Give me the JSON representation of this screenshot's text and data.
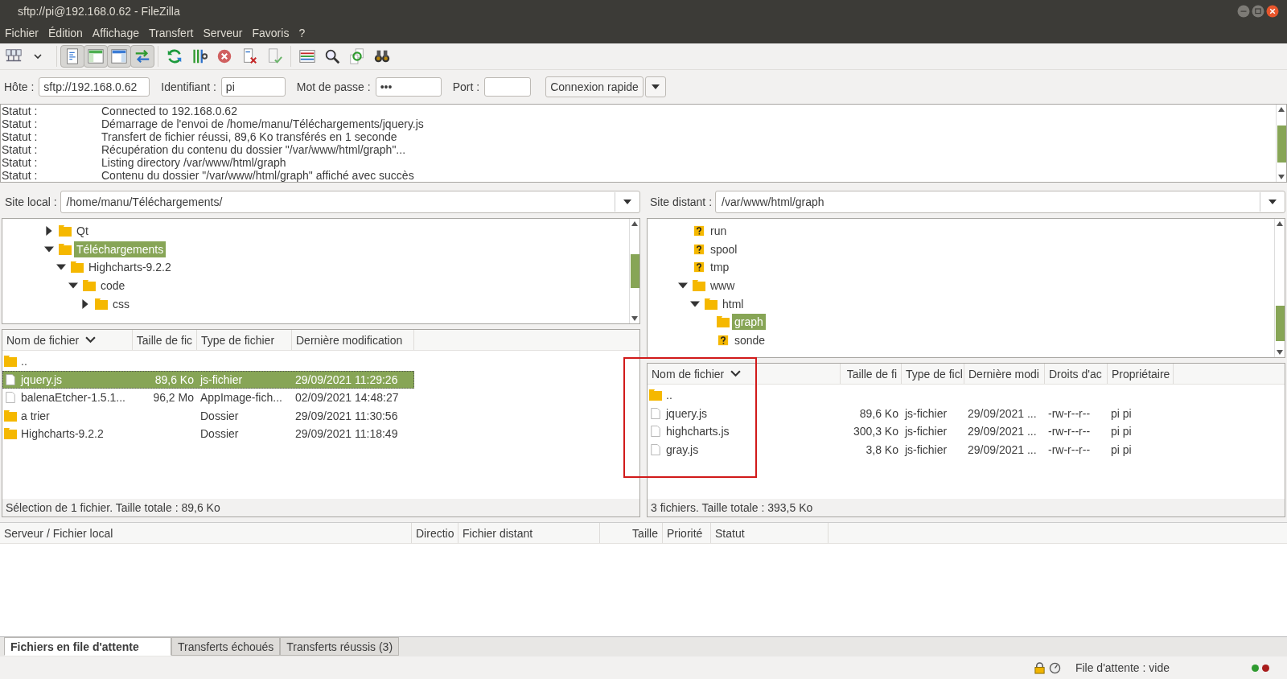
{
  "window": {
    "title": "sftp://pi@192.168.0.62 - FileZilla"
  },
  "menu": [
    "Fichier",
    "Édition",
    "Affichage",
    "Transfert",
    "Serveur",
    "Favoris",
    "?"
  ],
  "toolbar": {
    "toggles": [
      {
        "on": true
      },
      {
        "on": true
      },
      {
        "on": true
      },
      {
        "on": true
      }
    ]
  },
  "quickconnect": {
    "fields": [
      {
        "label": "Hôte :",
        "value": "sftp://192.168.0.62"
      },
      {
        "label": "Identifiant :",
        "value": "pi"
      },
      {
        "label": "Mot de passe :",
        "value": "•••"
      },
      {
        "label": "Port :"
      }
    ],
    "button": "Connexion rapide"
  },
  "log": [
    {
      "label": "Statut :",
      "message": "Connected to 192.168.0.62"
    },
    {
      "label": "Statut :",
      "message": "Démarrage de l'envoi de /home/manu/Téléchargements/jquery.js"
    },
    {
      "label": "Statut :",
      "message": "Transfert de fichier réussi, 89,6 Ko transférés en 1 seconde"
    },
    {
      "label": "Statut :",
      "message": "Récupération du contenu du dossier \"/var/www/html/graph\"..."
    },
    {
      "label": "Statut :",
      "message": "Listing directory /var/www/html/graph"
    },
    {
      "label": "Statut :",
      "message": "Contenu du dossier \"/var/www/html/graph\" affiché avec succès"
    }
  ],
  "local": {
    "label": "Site local :",
    "path": "/home/manu/Téléchargements/",
    "tree": [
      {
        "name": "Qt",
        "kind": "folder",
        "expanded": false,
        "selected": false
      },
      {
        "name": "Téléchargements",
        "kind": "folder",
        "expanded": true,
        "selected": true,
        "children": [
          {
            "name": "Highcharts-9.2.2",
            "kind": "folder",
            "expanded": true,
            "selected": false,
            "children": [
              {
                "name": "code",
                "kind": "folder",
                "expanded": true,
                "selected": false,
                "children": [
                  {
                    "name": "css",
                    "kind": "folder",
                    "expanded": false,
                    "selected": false
                  }
                ]
              }
            ]
          }
        ]
      }
    ],
    "columns": [
      "Nom de fichier",
      "Taille de fic",
      "Type de fichier",
      "Dernière modification"
    ],
    "rows": [
      {
        "kind": "folder",
        "name": "..",
        "selected": false
      },
      {
        "kind": "file",
        "name": "jquery.js",
        "size": "89,6 Ko",
        "type": "js-fichier",
        "modified": "29/09/2021 11:29:26",
        "selected": true
      },
      {
        "kind": "file",
        "name": "balenaEtcher-1.5.1...",
        "size": "96,2 Mo",
        "type": "AppImage-fich...",
        "modified": "02/09/2021 14:48:27",
        "selected": false
      },
      {
        "kind": "folder",
        "name": "a trier",
        "type": "Dossier",
        "modified": "29/09/2021 11:30:56",
        "selected": false
      },
      {
        "kind": "folder",
        "name": "Highcharts-9.2.2",
        "type": "Dossier",
        "modified": "29/09/2021 11:18:49",
        "selected": false
      }
    ],
    "status": "Sélection de 1 fichier. Taille totale : 89,6 Ko"
  },
  "remote": {
    "label": "Site distant :",
    "path": "/var/www/html/graph",
    "tree": [
      {
        "name": "run",
        "kind": "unknown",
        "selected": false
      },
      {
        "name": "spool",
        "kind": "unknown",
        "selected": false
      },
      {
        "name": "tmp",
        "kind": "unknown",
        "selected": false
      },
      {
        "name": "www",
        "kind": "folder",
        "expanded": true,
        "selected": false,
        "children": [
          {
            "name": "html",
            "kind": "folder",
            "expanded": true,
            "selected": false,
            "children": [
              {
                "name": "graph",
                "kind": "folder",
                "selected": true
              },
              {
                "name": "sonde",
                "kind": "unknown",
                "selected": false
              }
            ]
          }
        ]
      }
    ],
    "columns": [
      "Nom de fichier",
      "Taille de fi",
      "Type de ficl",
      "Dernière modi",
      "Droits d'ac",
      "Propriétaire"
    ],
    "rows": [
      {
        "kind": "folder",
        "name": "..",
        "selected": false
      },
      {
        "kind": "file",
        "name": "jquery.js",
        "size": "89,6 Ko",
        "type": "js-fichier",
        "modified": "29/09/2021 ...",
        "perms": "-rw-r--r--",
        "owner": "pi pi",
        "selected": false
      },
      {
        "kind": "file",
        "name": "highcharts.js",
        "size": "300,3 Ko",
        "type": "js-fichier",
        "modified": "29/09/2021 ...",
        "perms": "-rw-r--r--",
        "owner": "pi pi",
        "selected": false
      },
      {
        "kind": "file",
        "name": "gray.js",
        "size": "3,8 Ko",
        "type": "js-fichier",
        "modified": "29/09/2021 ...",
        "perms": "-rw-r--r--",
        "owner": "pi pi",
        "selected": false
      }
    ],
    "status": "3 fichiers. Taille totale : 393,5 Ko"
  },
  "queue": {
    "columns": [
      "Serveur / Fichier local",
      "Directio",
      "Fichier distant",
      "Taille",
      "Priorité",
      "Statut"
    ]
  },
  "tabs": [
    {
      "label": "Fichiers en file d'attente",
      "selected": true
    },
    {
      "label": "Transferts échoués",
      "selected": false
    },
    {
      "label": "Transferts réussis (3)",
      "selected": false
    }
  ],
  "status_bar": {
    "text": "File d'attente : vide",
    "lights": [
      {
        "color": "#2f9a2f"
      },
      {
        "color": "#a81c1c"
      }
    ]
  }
}
